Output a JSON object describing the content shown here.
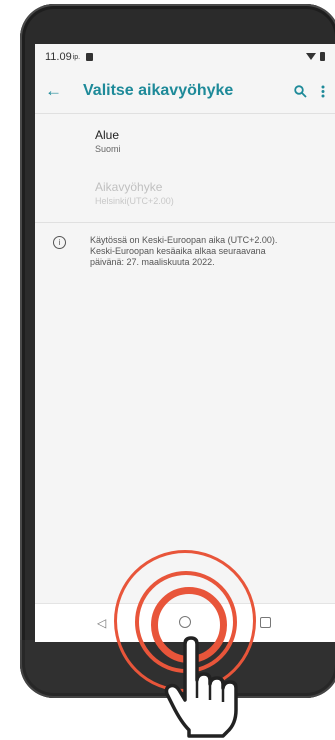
{
  "status_bar": {
    "time": "11.09",
    "ampm": "ip."
  },
  "app_bar": {
    "title": "Valitse aikavyöhyke"
  },
  "settings": [
    {
      "title": "Alue",
      "summary": "Suomi",
      "enabled": true
    },
    {
      "title": "Aikavyöhyke",
      "summary": "Helsinki(UTC+2.00)",
      "enabled": false
    }
  ],
  "info": {
    "line1": "Käytössä on Keski-Euroopan aika (UTC+2.00).",
    "line2": "Keski-Euroopan kesäaika alkaa seuraavana",
    "line3": "päivänä: 27. maaliskuuta 2022."
  },
  "colors": {
    "accent": "#1e8a99",
    "highlight": "#e8553a"
  },
  "icons": {
    "back": "arrow-left",
    "search": "magnifier",
    "more": "vertical-ellipsis",
    "info": "info-circle",
    "nav_back": "triangle-left",
    "nav_home": "circle",
    "nav_recent": "square"
  }
}
